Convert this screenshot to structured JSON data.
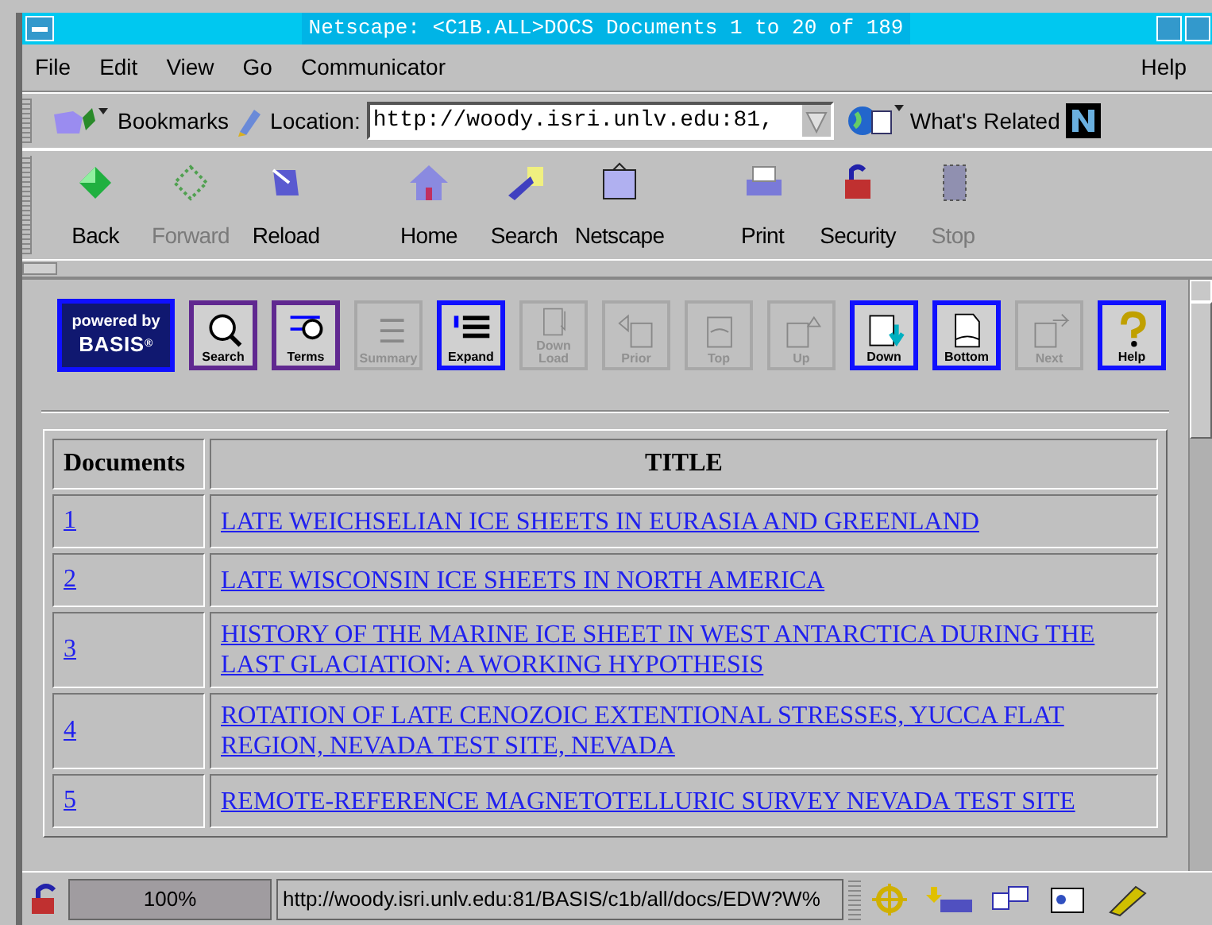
{
  "window": {
    "title": "Netscape: <C1B.ALL>DOCS Documents 1 to 20 of 189"
  },
  "menu": [
    "File",
    "Edit",
    "View",
    "Go",
    "Communicator"
  ],
  "menu_right": "Help",
  "location_bar": {
    "bookmarks": "Bookmarks",
    "location_label": "Location:",
    "url": "http://woody.isri.unlv.edu:81,",
    "related": "What's Related"
  },
  "toolbar": [
    {
      "label": "Back",
      "disabled": false
    },
    {
      "label": "Forward",
      "disabled": true
    },
    {
      "label": "Reload",
      "disabled": false
    },
    {
      "label": "Home",
      "disabled": false
    },
    {
      "label": "Search",
      "disabled": false
    },
    {
      "label": "Netscape",
      "disabled": false
    },
    {
      "label": "Print",
      "disabled": false
    },
    {
      "label": "Security",
      "disabled": false
    },
    {
      "label": "Stop",
      "disabled": true
    }
  ],
  "basis_logo": {
    "line_1": "powered by",
    "line_2": "BASIS",
    "mark": "®"
  },
  "basis_buttons": [
    {
      "label": "Search",
      "disabled": false,
      "visited": true
    },
    {
      "label": "Terms",
      "disabled": false,
      "visited": true
    },
    {
      "label": "Summary",
      "disabled": true,
      "visited": false
    },
    {
      "label": "Expand",
      "disabled": false,
      "visited": false
    },
    {
      "label": "Down Load",
      "disabled": true,
      "visited": false
    },
    {
      "label": "Prior",
      "disabled": true,
      "visited": false
    },
    {
      "label": "Top",
      "disabled": true,
      "visited": false
    },
    {
      "label": "Up",
      "disabled": true,
      "visited": false
    },
    {
      "label": "Down",
      "disabled": false,
      "visited": false
    },
    {
      "label": "Bottom",
      "disabled": false,
      "visited": false
    },
    {
      "label": "Next",
      "disabled": true,
      "visited": false
    },
    {
      "label": "Help",
      "disabled": false,
      "visited": false
    }
  ],
  "table": {
    "columns": [
      "Documents",
      "TITLE"
    ],
    "rows": [
      {
        "number": "1",
        "title": "LATE WEICHSELIAN ICE SHEETS IN EURASIA AND GREENLAND"
      },
      {
        "number": "2",
        "title": "LATE WISCONSIN ICE SHEETS IN NORTH AMERICA"
      },
      {
        "number": "3",
        "title": "HISTORY OF THE MARINE ICE SHEET IN WEST ANTARCTICA DURING THE LAST GLACIATION: A WORKING HYPOTHESIS"
      },
      {
        "number": "4",
        "title": "ROTATION OF LATE CENOZOIC EXTENTIONAL STRESSES, YUCCA FLAT REGION, NEVADA TEST SITE, NEVADA"
      },
      {
        "number": "5",
        "title": "REMOTE-REFERENCE MAGNETOTELLURIC SURVEY NEVADA TEST SITE"
      }
    ]
  },
  "status_bar": {
    "progress": "100%",
    "level": 1,
    "message": "http://woody.isri.unlv.edu:81/BASIS/c1b/all/docs/EDW?W%"
  }
}
